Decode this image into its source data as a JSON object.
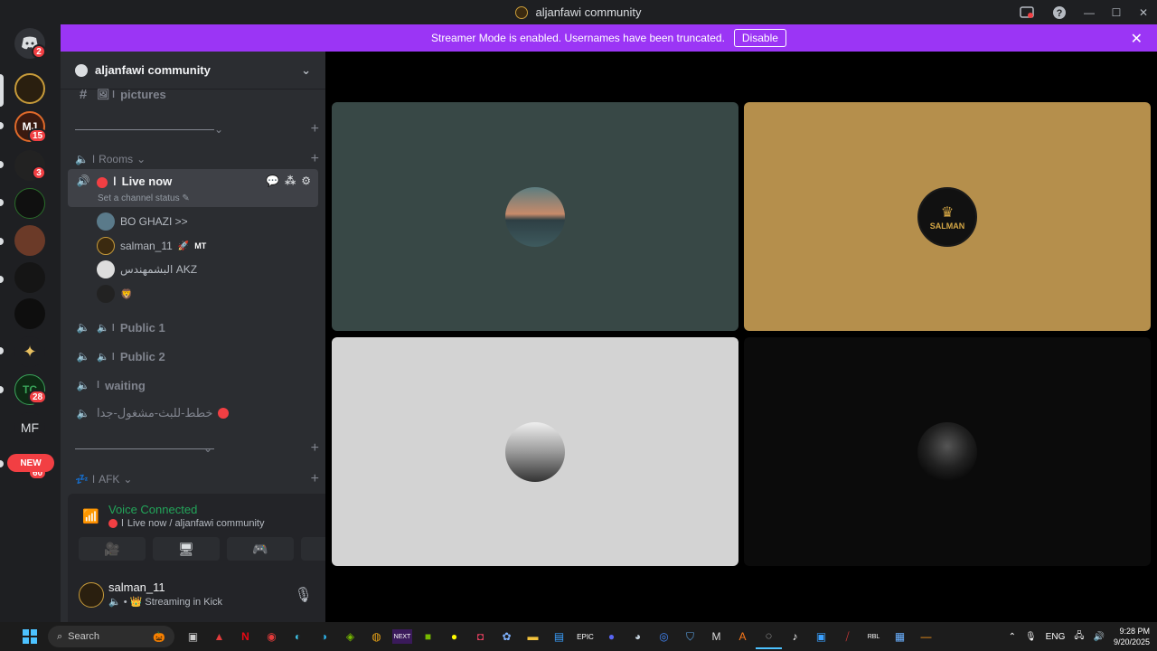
{
  "window": {
    "title": "aljanfawi community"
  },
  "banner": {
    "text": "Streamer Mode is enabled. Usernames have been truncated.",
    "disable_label": "Disable"
  },
  "rail": {
    "home_badge": "2",
    "server_badges": [
      "15",
      "3",
      "28",
      "60"
    ],
    "mf_label": "MF",
    "new_label": "NEW"
  },
  "sidebar": {
    "server_name": "aljanfawi community",
    "pictures_channel": "pictures",
    "rooms_category": "Rooms",
    "afk_category": "AFK",
    "live_channel": "Live now",
    "live_status": "Set a channel status",
    "users": [
      {
        "name": "BO GHAZI >>",
        "tag": ""
      },
      {
        "name": "salman_11",
        "tag": "MT"
      },
      {
        "name": "البشمهندس AKZ",
        "tag": ""
      },
      {
        "name": "",
        "tag": ""
      }
    ],
    "channels": [
      "Public 1",
      "Public 2",
      "waiting",
      "خطط-للبث-مشغول-جدا"
    ]
  },
  "voice": {
    "title": "Voice Connected",
    "subtitle": "Live now / aljanfawi community"
  },
  "userbar": {
    "name": "salman_11",
    "status": "Streaming in Kick"
  },
  "stage": {
    "tiles": [
      {
        "bg": "#384846",
        "avatar": "scenery"
      },
      {
        "bg": "#b58f4c",
        "avatar": "salman-lion",
        "avatar_label": "SALMAN"
      },
      {
        "bg": "#d3d3d3",
        "avatar": "gray-photo"
      },
      {
        "bg": "#0b0b0b",
        "avatar": "black-lion"
      }
    ]
  },
  "taskbar": {
    "search_placeholder": "Search",
    "lang": "ENG",
    "time": "9:28 PM",
    "date": "9/20/2025"
  },
  "colors": {
    "accent_purple": "#9b35f5",
    "voice_green": "#23a55a",
    "red": "#f23f43"
  }
}
